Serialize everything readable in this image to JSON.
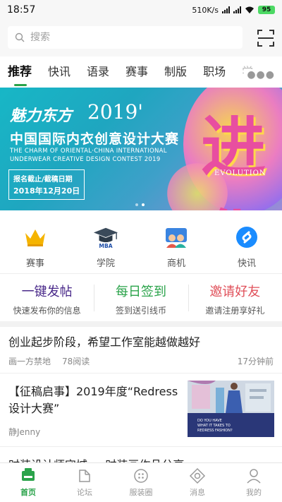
{
  "status": {
    "time": "18:57",
    "speed": "510K/s",
    "battery": "95"
  },
  "search": {
    "placeholder": "搜索"
  },
  "tabs": [
    {
      "label": "推荐",
      "active": true
    },
    {
      "label": "快讯"
    },
    {
      "label": "语录"
    },
    {
      "label": "赛事"
    },
    {
      "label": "制版"
    },
    {
      "label": "职场"
    },
    {
      "label": "学"
    }
  ],
  "banner": {
    "brand": "魅力东方",
    "year": "2019'",
    "title": "中国国际内衣创意设计大赛",
    "subtitle_en_1": "THE CHARM OF ORIENTAL·CHINA INTERNATIONAL",
    "subtitle_en_2": "UNDERWEAR CREATIVE DESIGN CONTEST 2019",
    "deadline_label": "报名截止/截稿日期",
    "deadline_date": "2018年12月20日",
    "big_char": "进化",
    "evolution": "EVOLUTION"
  },
  "categories": [
    {
      "label": "赛事",
      "icon": "crown-icon"
    },
    {
      "label": "学院",
      "icon": "graduation-cap-icon",
      "badge": "MBA"
    },
    {
      "label": "商机",
      "icon": "people-icon"
    },
    {
      "label": "快讯",
      "icon": "shazam-icon"
    }
  ],
  "actions": [
    {
      "title": "一键发帖",
      "subtitle": "快速发布你的信息",
      "color": "#4a2a8a"
    },
    {
      "title": "每日签到",
      "subtitle": "签到送引线币",
      "color": "#2aa34a"
    },
    {
      "title": "邀请好友",
      "subtitle": "邀请注册享好礼",
      "color": "#e0505a"
    }
  ],
  "feed": [
    {
      "title": "创业起步阶段，希望工作室能越做越好",
      "author": "画一方禁地",
      "reads": "78阅读",
      "time": "17分钟前"
    },
    {
      "title": "【征稿启事】2019年度“Redress设计大赛”",
      "author": "静Jenny",
      "thumb_text": "DO YOU HAVE WHAT IT TAKES TO REDRESS FASHION?"
    },
    {
      "title": "时装设计师守城 ... 时装画作品分享"
    }
  ],
  "bottom_nav": [
    {
      "label": "首页",
      "icon": "home-icon",
      "active": true
    },
    {
      "label": "论坛",
      "icon": "forum-icon"
    },
    {
      "label": "服装圈",
      "icon": "button-icon"
    },
    {
      "label": "消息",
      "icon": "message-icon"
    },
    {
      "label": "我的",
      "icon": "profile-icon"
    }
  ],
  "colors": {
    "accent": "#2aa34a",
    "background": "#f7f7f7"
  }
}
